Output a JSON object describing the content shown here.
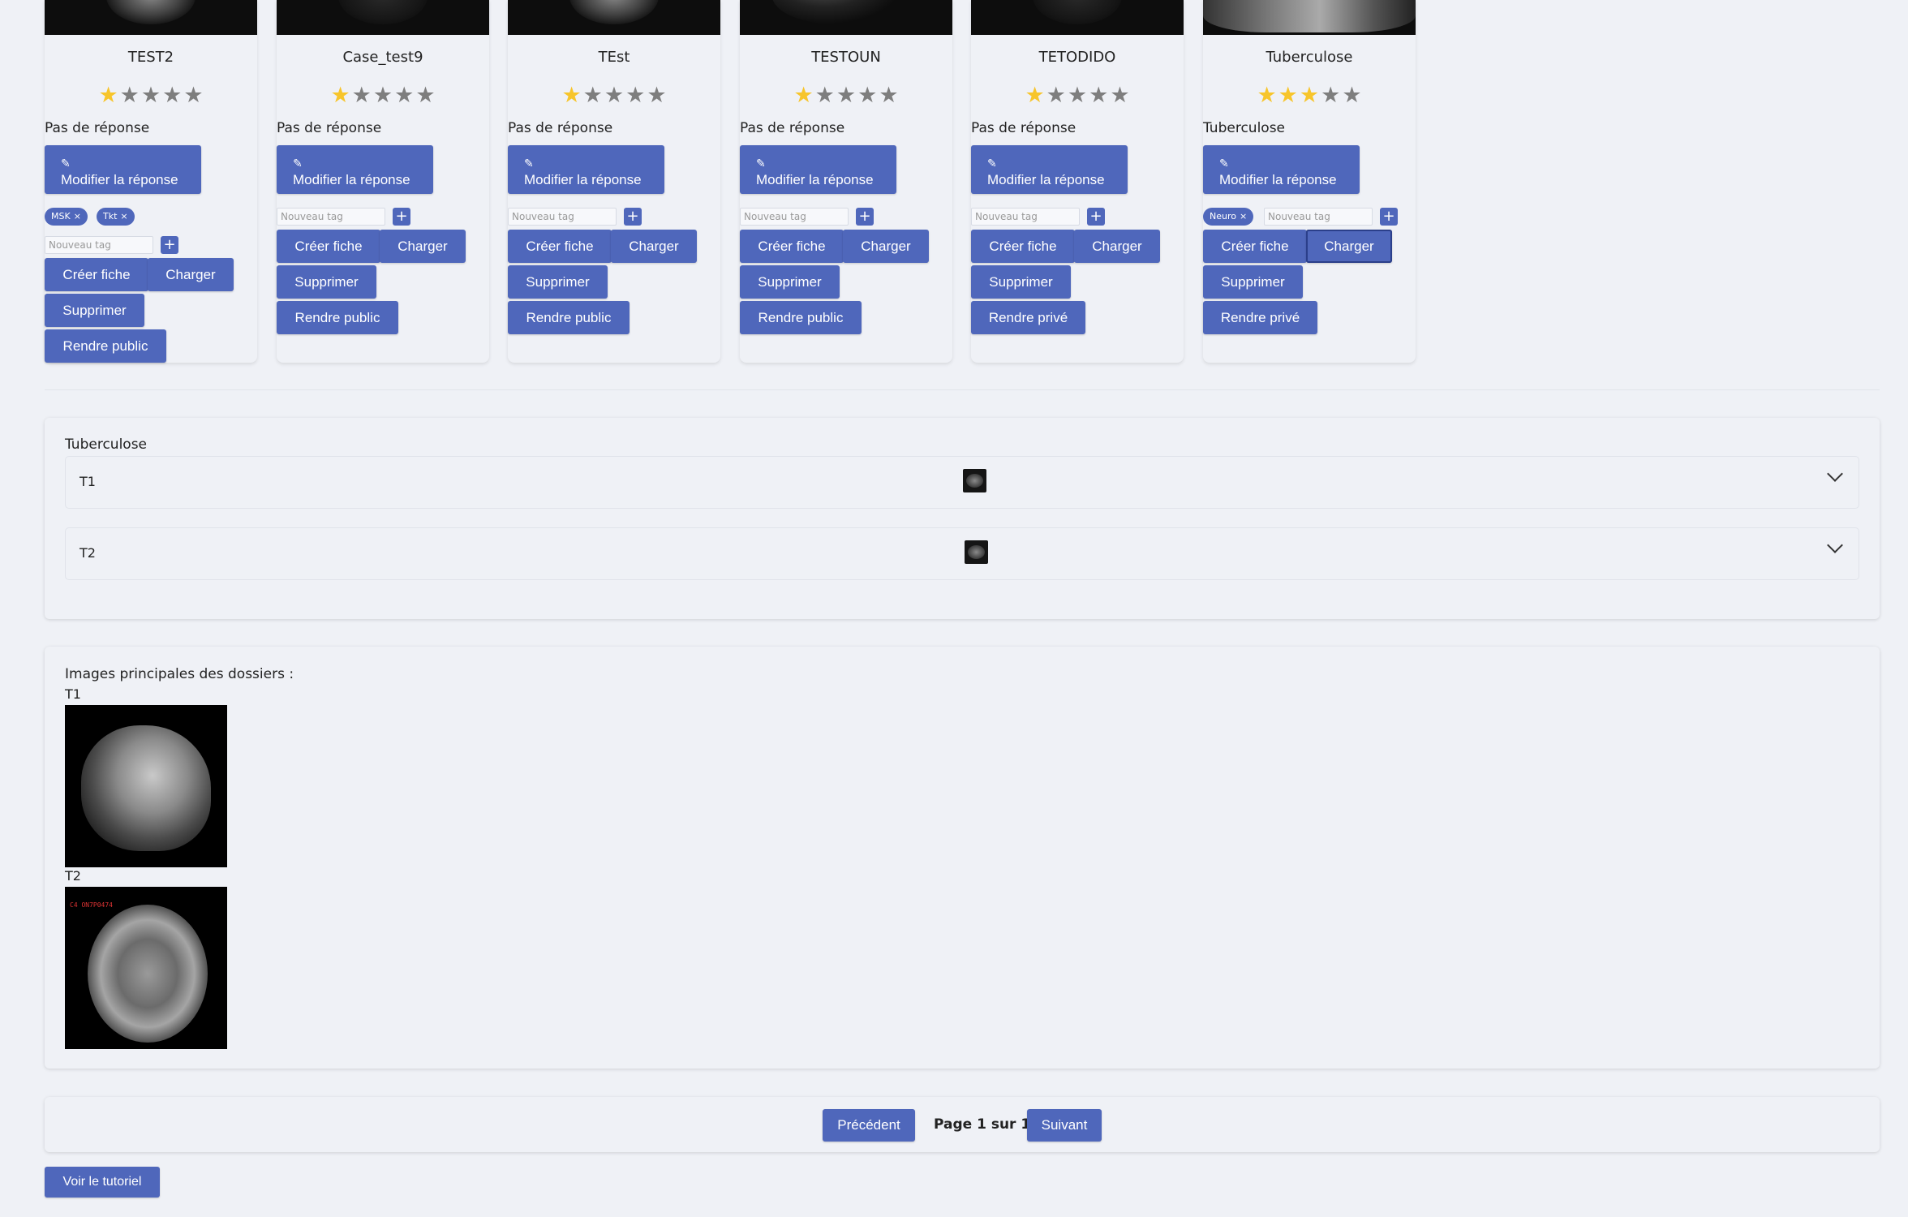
{
  "cases": [
    {
      "title": "TEST2",
      "rating": 1,
      "answer": "Pas de réponse",
      "edit_label": "Modifier la réponse",
      "tags": [
        "MSK",
        "Tkt"
      ],
      "tag_placeholder": "Nouveau tag",
      "create_label": "Créer fiche",
      "load_label": "Charger",
      "delete_label": "Supprimer",
      "visibility_label": "Rendre public"
    },
    {
      "title": "Case_test9",
      "rating": 1,
      "answer": "Pas de réponse",
      "edit_label": "Modifier la réponse",
      "tags": [],
      "tag_placeholder": "Nouveau tag",
      "create_label": "Créer fiche",
      "load_label": "Charger",
      "delete_label": "Supprimer",
      "visibility_label": "Rendre public"
    },
    {
      "title": "TEst",
      "rating": 1,
      "answer": "Pas de réponse",
      "edit_label": "Modifier la réponse",
      "tags": [],
      "tag_placeholder": "Nouveau tag",
      "create_label": "Créer fiche",
      "load_label": "Charger",
      "delete_label": "Supprimer",
      "visibility_label": "Rendre public"
    },
    {
      "title": "TESTOUN",
      "rating": 1,
      "answer": "Pas de réponse",
      "edit_label": "Modifier la réponse",
      "tags": [],
      "tag_placeholder": "Nouveau tag",
      "create_label": "Créer fiche",
      "load_label": "Charger",
      "delete_label": "Supprimer",
      "visibility_label": "Rendre public"
    },
    {
      "title": "TETODIDO",
      "rating": 1,
      "answer": "Pas de réponse",
      "edit_label": "Modifier la réponse",
      "tags": [],
      "tag_placeholder": "Nouveau tag",
      "create_label": "Créer fiche",
      "load_label": "Charger",
      "delete_label": "Supprimer",
      "visibility_label": "Rendre privé"
    },
    {
      "title": "Tuberculose",
      "rating": 3,
      "answer": "Tuberculose",
      "edit_label": "Modifier la réponse",
      "tags": [
        "Neuro"
      ],
      "tag_placeholder": "Nouveau tag",
      "create_label": "Créer fiche",
      "load_label": "Charger",
      "delete_label": "Supprimer",
      "visibility_label": "Rendre privé"
    }
  ],
  "max_rating": 5,
  "tag_add_symbol": "+",
  "tag_remove_symbol": "×",
  "star_symbol": "★",
  "edit_icon_symbol": "✎",
  "accent_color": "#4f67bb",
  "star_color": "#f7c52b",
  "case_detail": {
    "title": "Tuberculose",
    "sequences": [
      {
        "name": "T1"
      },
      {
        "name": "T2"
      }
    ]
  },
  "main_images": {
    "heading": "Images principales des dossiers :",
    "items": [
      {
        "label": "T1"
      },
      {
        "label": "T2",
        "note": "C4 ON7P0474"
      }
    ]
  },
  "pagination": {
    "prev_label": "Précédent",
    "page_text": "Page 1 sur 1",
    "next_label": "Suivant"
  },
  "tutorial_label": "Voir le tutoriel"
}
